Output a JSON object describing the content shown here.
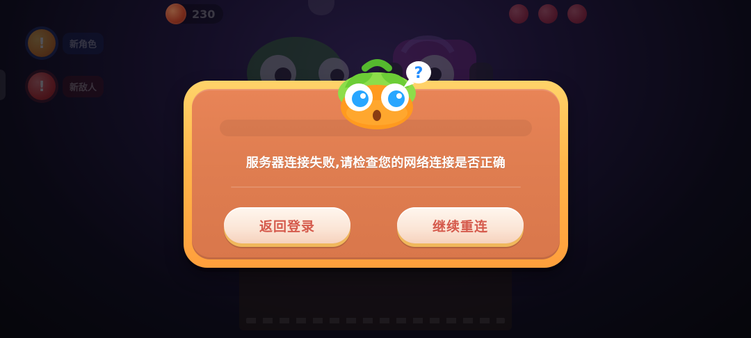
{
  "hud": {
    "coin_value": "230",
    "icons": [
      "coin-icon",
      "profile-badge-icon",
      "hud-icon-1",
      "hud-icon-2",
      "menu-icon"
    ]
  },
  "side_menu": {
    "items": [
      {
        "id": "new-character",
        "icon": "info-badge-icon",
        "label": "新角色"
      },
      {
        "id": "new-enemy",
        "icon": "alert-badge-icon",
        "label": "新敌人"
      }
    ]
  },
  "dialog": {
    "message": "服务器连接失败,请检查您的网络连接是否正确",
    "buttons": {
      "back_to_login": "返回登录",
      "retry": "继续重连"
    }
  },
  "icons": {
    "mascot": "question-mascot-icon",
    "question": "question-bubble-icon"
  },
  "colors": {
    "dialog_fill": "#E07E51",
    "dialog_border": "#FFB64A",
    "button_fill": "#FBE5D6",
    "button_text": "#D55A4C",
    "message_text": "#FFFFFF"
  }
}
